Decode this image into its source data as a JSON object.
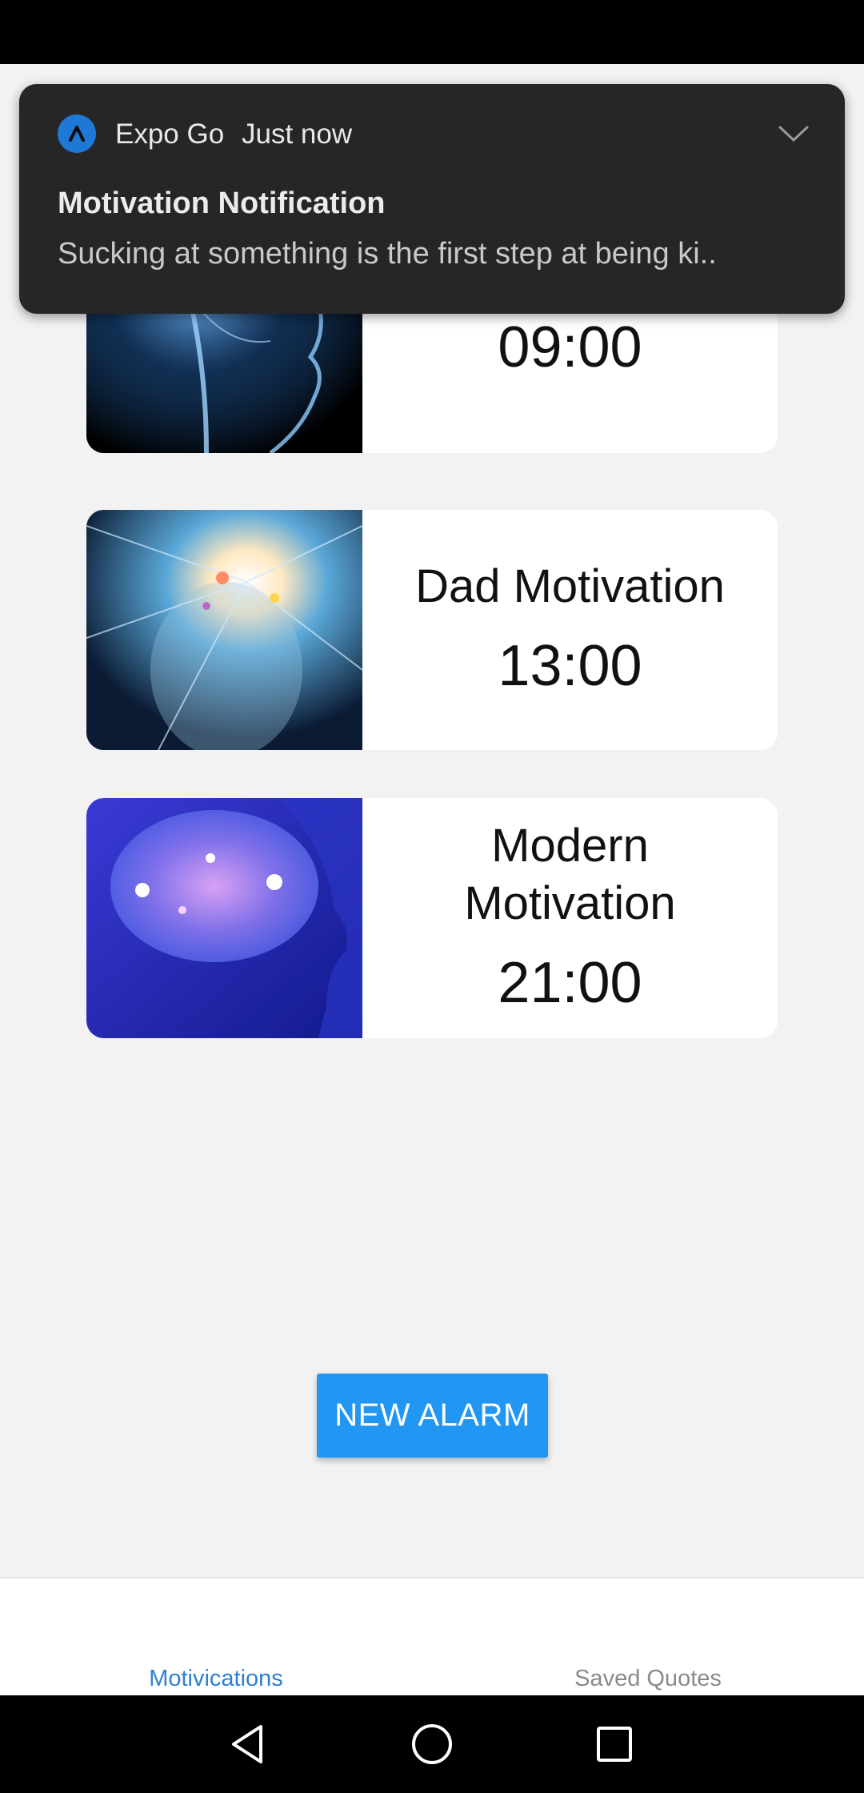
{
  "notification": {
    "app_name": "Expo Go",
    "time": "Just now",
    "title": "Motivation Notification",
    "body": "Sucking at something is the first step at being ki.."
  },
  "alarms": [
    {
      "title": "",
      "time": "09:00",
      "image": "brain-xray-image"
    },
    {
      "title": "Dad Motivation",
      "time": "13:00",
      "image": "glowing-head-image"
    },
    {
      "title": "Modern Motivation",
      "time": "21:00",
      "image": "neon-brain-image"
    }
  ],
  "new_alarm_label": "NEW ALARM",
  "tabs": [
    {
      "label": "Motivications",
      "active": true
    },
    {
      "label": "Saved Quotes",
      "active": false
    }
  ],
  "colors": {
    "accent": "#2196f3",
    "tab_active": "#2f80d1",
    "notification_bg": "#262626"
  }
}
